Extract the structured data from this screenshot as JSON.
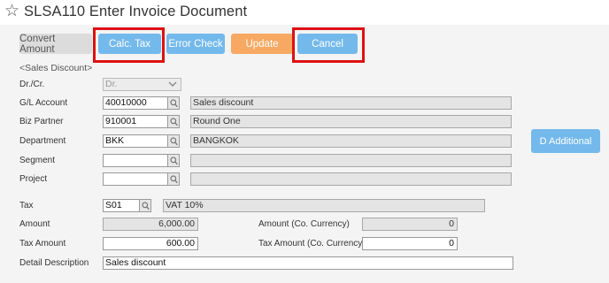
{
  "window": {
    "title": "SLSA110 Enter Invoice Document"
  },
  "toolbar": {
    "convert_amount": "Convert Amount",
    "calc_tax": "Calc. Tax",
    "error_check": "Error Check",
    "update": "Update",
    "cancel": "Cancel"
  },
  "section_title": "<Sales Discount>",
  "form": {
    "dr_cr": {
      "label": "Dr./Cr.",
      "value": "Dr."
    },
    "gl_account": {
      "label": "G/L Account",
      "value": "40010000",
      "desc": "Sales discount"
    },
    "biz_partner": {
      "label": "Biz Partner",
      "value": "910001",
      "desc": "Round One"
    },
    "department": {
      "label": "Department",
      "value": "BKK",
      "desc": "BANGKOK"
    },
    "segment": {
      "label": "Segment",
      "value": "",
      "desc": ""
    },
    "project": {
      "label": "Project",
      "value": "",
      "desc": ""
    },
    "tax": {
      "label": "Tax",
      "value": "S01",
      "desc": "VAT 10%"
    },
    "amount": {
      "label": "Amount",
      "value": "6,000.00"
    },
    "amount_co": {
      "label": "Amount (Co. Currency)",
      "value": "0"
    },
    "tax_amount": {
      "label": "Tax Amount",
      "value": "600.00"
    },
    "tax_amount_co": {
      "label": "Tax Amount (Co. Currency)",
      "value": "0"
    },
    "detail_description": {
      "label": "Detail Description",
      "value": "Sales discount"
    }
  },
  "d_additional": "D Additional",
  "colors": {
    "primary_button": "#74b9ec",
    "update_button": "#f7a862",
    "highlight": "#e01010"
  }
}
